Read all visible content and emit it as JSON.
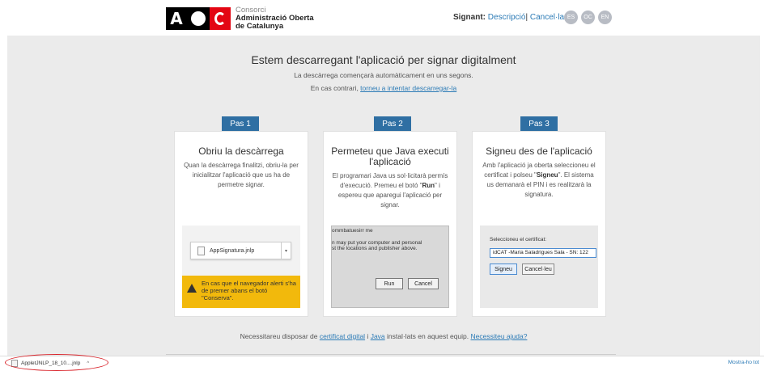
{
  "header": {
    "logo_text_1": "Consorci",
    "logo_text_2": "Administració Oberta",
    "logo_text_3": "de Catalunya",
    "signant_label": "Signant:",
    "signant_desc": "Descripció",
    "signant_sep": "|",
    "signant_cancel": "Cancel·la",
    "languages": [
      "ES",
      "OC",
      "EN"
    ]
  },
  "main": {
    "title": "Estem descarregant l'aplicació per signar digitalment",
    "subtitle": "La descàrrega començarà automàticament en uns segons.",
    "retry_prefix": "En cas contrari, ",
    "retry_link": "torneu a intentar descarregar-la"
  },
  "steps": [
    {
      "badge": "Pas 1",
      "title": "Obriu la descàrrega",
      "text": "Quan la descàrrega finalitzi, obriu-la per inicialitzar l'aplicació que us ha de permetre signar.",
      "file_name": "AppSignatura.jnlp",
      "warning": "En cas que el navegador alerti s'ha de premer abans el botó \"Conserva\"."
    },
    {
      "badge": "Pas 2",
      "title": "Permeteu que Java executi l'aplicació",
      "text_1": "El programari Java us sol·licitarà permís d'execució. Premeu el botó \"",
      "text_bold": "Run",
      "text_2": "\" i espereu que aparegui l'aplicació per signar.",
      "dialog_line_1": "ommbatuesirr me",
      "dialog_line_2": "n may put your computer and personal",
      "dialog_line_3": "st the locations and publisher above.",
      "run_label": "Run",
      "cancel_label": "Cancel"
    },
    {
      "badge": "Pas 3",
      "title": "Signeu des de l'aplicació",
      "text_1": "Amb l'aplicació ja oberta seleccioneu el certificat i polseu \"",
      "text_bold": "Signeu",
      "text_2": "\". El sistema us demanarà el PIN i es realitzarà la signatura.",
      "cert_label": "Seleccioneu el certificat:",
      "cert_value": "idCAT -Maria Saladrigues Sala - SN: 122",
      "sign_label": "Signeu",
      "cancel_label": "Cancel·leu"
    }
  ],
  "footer": {
    "prefix": "Necessitareu disposar de ",
    "cert_link": "certificat digital",
    "mid": " i ",
    "java_link": "Java",
    "suffix": " instal·lats en aquest equip. ",
    "help_link": "Necessiteu ajuda?"
  },
  "download_bar": {
    "file": "AppletJNLP_18_10....jnlp",
    "chevron": "^",
    "show_all": "Mostra-ho tot"
  },
  "colors": {
    "accent": "#2f6fa3",
    "link": "#2c7bb6",
    "warning": "#f2b90c",
    "highlight_ring": "#d9232a"
  }
}
